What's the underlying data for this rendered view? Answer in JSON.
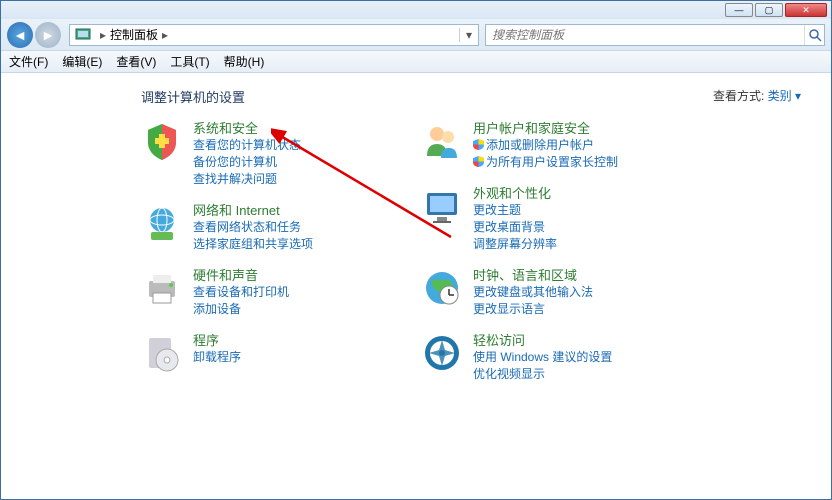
{
  "breadcrumb": {
    "location": "控制面板"
  },
  "search": {
    "placeholder": "搜索控制面板"
  },
  "menubar": {
    "file": "文件(F)",
    "edit": "编辑(E)",
    "view": "查看(V)",
    "tools": "工具(T)",
    "help": "帮助(H)"
  },
  "page": {
    "title": "调整计算机的设置",
    "viewby_label": "查看方式:",
    "viewby_value": "类别"
  },
  "categories": {
    "left": [
      {
        "title": "系统和安全",
        "links": [
          "查看您的计算机状态",
          "备份您的计算机",
          "查找并解决问题"
        ]
      },
      {
        "title": "网络和 Internet",
        "links": [
          "查看网络状态和任务",
          "选择家庭组和共享选项"
        ]
      },
      {
        "title": "硬件和声音",
        "links": [
          "查看设备和打印机",
          "添加设备"
        ]
      },
      {
        "title": "程序",
        "links": [
          "卸载程序"
        ]
      }
    ],
    "right": [
      {
        "title": "用户帐户和家庭安全",
        "shield_links": [
          "添加或删除用户帐户",
          "为所有用户设置家长控制"
        ]
      },
      {
        "title": "外观和个性化",
        "links": [
          "更改主题",
          "更改桌面背景",
          "调整屏幕分辨率"
        ]
      },
      {
        "title": "时钟、语言和区域",
        "links": [
          "更改键盘或其他输入法",
          "更改显示语言"
        ]
      },
      {
        "title": "轻松访问",
        "links": [
          "使用 Windows 建议的设置",
          "优化视频显示"
        ]
      }
    ]
  }
}
